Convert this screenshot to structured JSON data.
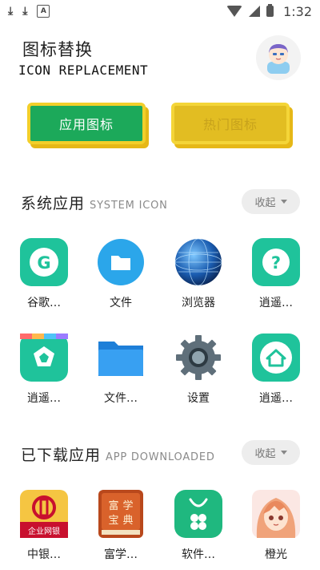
{
  "status_bar": {
    "time": "1:32",
    "icons": [
      "download-icon",
      "download-icon",
      "text-icon",
      "wifi-icon",
      "signal-icon",
      "battery-icon"
    ]
  },
  "header": {
    "title_zh": "图标替换",
    "title_en": "ICON REPLACEMENT",
    "avatar": "avatar"
  },
  "tabs": {
    "app_icons": "应用图标",
    "hot_icons": "热门图标"
  },
  "system_section": {
    "title_zh": "系统应用",
    "title_en": "SYSTEM ICON",
    "collapse_label": "收起",
    "apps": [
      {
        "label": "谷歌…",
        "icon": "google-icon"
      },
      {
        "label": "文件",
        "icon": "folder-icon"
      },
      {
        "label": "浏览器",
        "icon": "globe-icon"
      },
      {
        "label": "逍遥…",
        "icon": "help-icon"
      },
      {
        "label": "逍遥…",
        "icon": "store-icon"
      },
      {
        "label": "文件…",
        "icon": "blue-folder-icon"
      },
      {
        "label": "设置",
        "icon": "gear-icon"
      },
      {
        "label": "逍遥…",
        "icon": "home-icon"
      }
    ]
  },
  "downloaded_section": {
    "title_zh": "已下载应用",
    "title_en": "APP DOWNLOADED",
    "collapse_label": "收起",
    "apps": [
      {
        "label": "中银…",
        "icon": "bank-icon",
        "icon_text": "企业网银"
      },
      {
        "label": "富学…",
        "icon": "book-icon",
        "icon_text": "富学宝典"
      },
      {
        "label": "软件…",
        "icon": "bag-icon"
      },
      {
        "label": "橙光",
        "icon": "anime-girl-icon"
      }
    ]
  },
  "colors": {
    "accent_green": "#1ca95a",
    "accent_yellow": "#e2bd22",
    "teal": "#1fc39b"
  }
}
